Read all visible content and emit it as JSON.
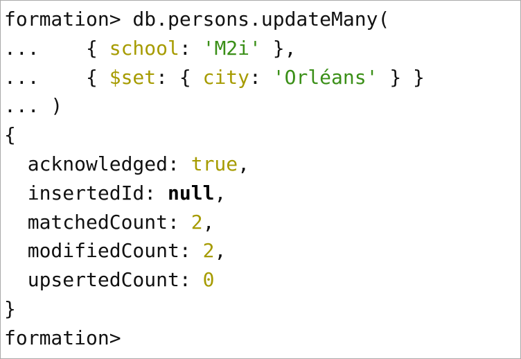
{
  "terminal": {
    "top_fragment": "¯",
    "lines": [
      [
        {
          "t": "formation> db.persons.updateMany(",
          "c": "plain"
        }
      ],
      [
        {
          "t": "...    { ",
          "c": "plain"
        },
        {
          "t": "school",
          "c": "kw"
        },
        {
          "t": ": ",
          "c": "plain"
        },
        {
          "t": "'M2i'",
          "c": "str"
        },
        {
          "t": " },",
          "c": "plain"
        }
      ],
      [
        {
          "t": "...    { ",
          "c": "plain"
        },
        {
          "t": "$set",
          "c": "kw"
        },
        {
          "t": ": { ",
          "c": "plain"
        },
        {
          "t": "city",
          "c": "kw"
        },
        {
          "t": ": ",
          "c": "plain"
        },
        {
          "t": "'Orléans'",
          "c": "str"
        },
        {
          "t": " } }",
          "c": "plain"
        }
      ],
      [
        {
          "t": "... )",
          "c": "plain"
        }
      ],
      [
        {
          "t": "{",
          "c": "plain"
        }
      ],
      [
        {
          "t": "  acknowledged: ",
          "c": "plain"
        },
        {
          "t": "true",
          "c": "kw"
        },
        {
          "t": ",",
          "c": "plain"
        }
      ],
      [
        {
          "t": "  insertedId: ",
          "c": "plain"
        },
        {
          "t": "null",
          "c": "bold"
        },
        {
          "t": ",",
          "c": "plain"
        }
      ],
      [
        {
          "t": "  matchedCount: ",
          "c": "plain"
        },
        {
          "t": "2",
          "c": "kw"
        },
        {
          "t": ",",
          "c": "plain"
        }
      ],
      [
        {
          "t": "  modifiedCount: ",
          "c": "plain"
        },
        {
          "t": "2",
          "c": "kw"
        },
        {
          "t": ",",
          "c": "plain"
        }
      ],
      [
        {
          "t": "  upsertedCount: ",
          "c": "plain"
        },
        {
          "t": "0",
          "c": "kw"
        }
      ],
      [
        {
          "t": "}",
          "c": "plain"
        }
      ],
      [
        {
          "t": "formation>",
          "c": "plain"
        }
      ]
    ],
    "colors": {
      "keyword": "#a69b00",
      "string": "#3a8f17",
      "text": "#111111",
      "border": "#a9a9a9"
    }
  }
}
